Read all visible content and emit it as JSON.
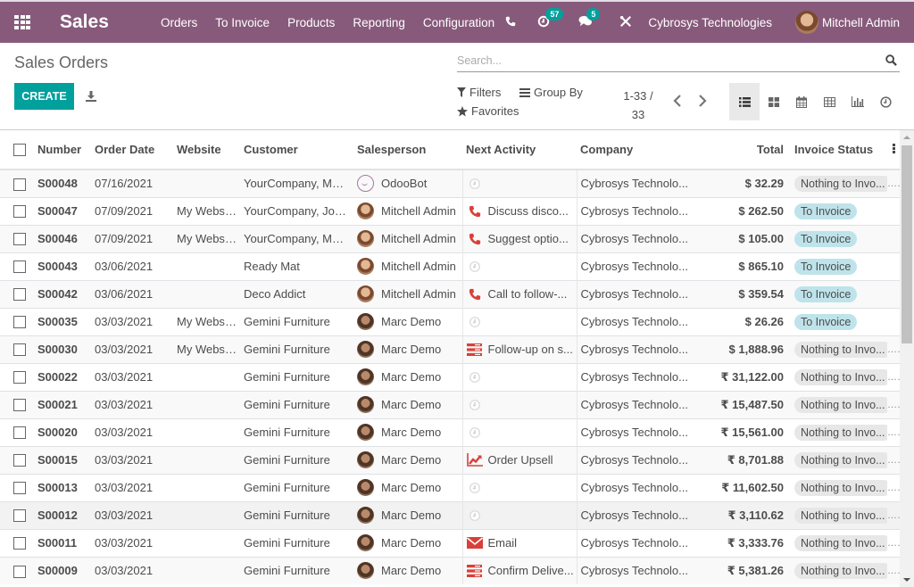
{
  "navbar": {
    "brand": "Sales",
    "menu": [
      "Orders",
      "To Invoice",
      "Products",
      "Reporting",
      "Configuration"
    ],
    "activity_count": "57",
    "message_count": "5",
    "company": "Cybrosys Technologies",
    "user": "Mitchell Admin"
  },
  "control_panel": {
    "breadcrumb": "Sales Orders",
    "create_label": "CREATE",
    "search_placeholder": "Search...",
    "filters_label": "Filters",
    "group_by_label": "Group By",
    "favorites_label": "Favorites",
    "pager_range": "1-33 /",
    "pager_total": "33",
    "views": [
      "list",
      "kanban",
      "calendar",
      "pivot",
      "graph",
      "activity"
    ],
    "active_view": "list"
  },
  "table": {
    "columns": [
      "Number",
      "Order Date",
      "Website",
      "Customer",
      "Salesperson",
      "Next Activity",
      "Company",
      "Total",
      "Invoice Status"
    ],
    "rows": [
      {
        "number": "S00048",
        "date": "07/16/2021",
        "website": "",
        "customer": "YourCompany, Mar...",
        "salesperson": "OdooBot",
        "sp_type": "bot",
        "activity_icon": "clock",
        "activity": "",
        "company": "Cybrosys Technolo...",
        "total": "$ 32.29",
        "status": "Nothing to Invo...",
        "status_type": "muted"
      },
      {
        "number": "S00047",
        "date": "07/09/2021",
        "website": "My Website",
        "customer": "YourCompany, Joe...",
        "salesperson": "Mitchell Admin",
        "sp_type": "mitchell",
        "activity_icon": "phone",
        "activity": "Discuss disco...",
        "company": "Cybrosys Technolo...",
        "total": "$ 262.50",
        "status": "To Invoice",
        "status_type": "info"
      },
      {
        "number": "S00046",
        "date": "07/09/2021",
        "website": "My Website",
        "customer": "YourCompany, Mar...",
        "salesperson": "Mitchell Admin",
        "sp_type": "mitchell",
        "activity_icon": "phone",
        "activity": "Suggest optio...",
        "company": "Cybrosys Technolo...",
        "total": "$ 105.00",
        "status": "To Invoice",
        "status_type": "info"
      },
      {
        "number": "S00043",
        "date": "03/06/2021",
        "website": "",
        "customer": "Ready Mat",
        "salesperson": "Mitchell Admin",
        "sp_type": "mitchell",
        "activity_icon": "clock",
        "activity": "",
        "company": "Cybrosys Technolo...",
        "total": "$ 865.10",
        "status": "To Invoice",
        "status_type": "info"
      },
      {
        "number": "S00042",
        "date": "03/06/2021",
        "website": "",
        "customer": "Deco Addict",
        "salesperson": "Mitchell Admin",
        "sp_type": "mitchell",
        "activity_icon": "phone",
        "activity": "Call to follow-...",
        "company": "Cybrosys Technolo...",
        "total": "$ 359.54",
        "status": "To Invoice",
        "status_type": "info"
      },
      {
        "number": "S00035",
        "date": "03/03/2021",
        "website": "My Website",
        "customer": "Gemini Furniture",
        "salesperson": "Marc Demo",
        "sp_type": "marc",
        "activity_icon": "clock",
        "activity": "",
        "company": "Cybrosys Technolo...",
        "total": "$ 26.26",
        "status": "To Invoice",
        "status_type": "info"
      },
      {
        "number": "S00030",
        "date": "03/03/2021",
        "website": "My Website",
        "customer": "Gemini Furniture",
        "salesperson": "Marc Demo",
        "sp_type": "marc",
        "activity_icon": "tasks",
        "activity": "Follow-up on s...",
        "company": "Cybrosys Technolo...",
        "total": "$ 1,888.96",
        "status": "Nothing to Invo...",
        "status_type": "muted"
      },
      {
        "number": "S00022",
        "date": "03/03/2021",
        "website": "",
        "customer": "Gemini Furniture",
        "salesperson": "Marc Demo",
        "sp_type": "marc",
        "activity_icon": "clock",
        "activity": "",
        "company": "Cybrosys Technolo...",
        "total": "₹ 31,122.00",
        "status": "Nothing to Invo...",
        "status_type": "muted"
      },
      {
        "number": "S00021",
        "date": "03/03/2021",
        "website": "",
        "customer": "Gemini Furniture",
        "salesperson": "Marc Demo",
        "sp_type": "marc",
        "activity_icon": "clock",
        "activity": "",
        "company": "Cybrosys Technolo...",
        "total": "₹ 15,487.50",
        "status": "Nothing to Invo...",
        "status_type": "muted"
      },
      {
        "number": "S00020",
        "date": "03/03/2021",
        "website": "",
        "customer": "Gemini Furniture",
        "salesperson": "Marc Demo",
        "sp_type": "marc",
        "activity_icon": "clock",
        "activity": "",
        "company": "Cybrosys Technolo...",
        "total": "₹ 15,561.00",
        "status": "Nothing to Invo...",
        "status_type": "muted"
      },
      {
        "number": "S00015",
        "date": "03/03/2021",
        "website": "",
        "customer": "Gemini Furniture",
        "salesperson": "Marc Demo",
        "sp_type": "marc",
        "activity_icon": "chart",
        "activity": "Order Upsell",
        "company": "Cybrosys Technolo...",
        "total": "₹ 8,701.88",
        "status": "Nothing to Invo...",
        "status_type": "muted"
      },
      {
        "number": "S00013",
        "date": "03/03/2021",
        "website": "",
        "customer": "Gemini Furniture",
        "salesperson": "Marc Demo",
        "sp_type": "marc",
        "activity_icon": "clock",
        "activity": "",
        "company": "Cybrosys Technolo...",
        "total": "₹ 11,602.50",
        "status": "Nothing to Invo...",
        "status_type": "muted"
      },
      {
        "number": "S00012",
        "date": "03/03/2021",
        "website": "",
        "customer": "Gemini Furniture",
        "salesperson": "Marc Demo",
        "sp_type": "marc",
        "activity_icon": "clock",
        "activity": "",
        "company": "Cybrosys Technolo...",
        "total": "₹ 3,110.62",
        "status": "Nothing to Invo...",
        "status_type": "muted",
        "hovered": true
      },
      {
        "number": "S00011",
        "date": "03/03/2021",
        "website": "",
        "customer": "Gemini Furniture",
        "salesperson": "Marc Demo",
        "sp_type": "marc",
        "activity_icon": "email",
        "activity": "Email",
        "company": "Cybrosys Technolo...",
        "total": "₹ 3,333.76",
        "status": "Nothing to Invo...",
        "status_type": "muted"
      },
      {
        "number": "S00009",
        "date": "03/03/2021",
        "website": "",
        "customer": "Gemini Furniture",
        "salesperson": "Marc Demo",
        "sp_type": "marc",
        "activity_icon": "tasks",
        "activity": "Confirm Delive...",
        "company": "Cybrosys Technolo...",
        "total": "₹ 5,381.26",
        "status": "Nothing to Invo...",
        "status_type": "muted"
      }
    ]
  },
  "colors": {
    "brand": "#875a7b",
    "primary": "#00a09d",
    "activity_red": "#d9403a",
    "to_invoice_badge": "#bfe3ea",
    "nothing_badge": "#e7e7e7"
  }
}
